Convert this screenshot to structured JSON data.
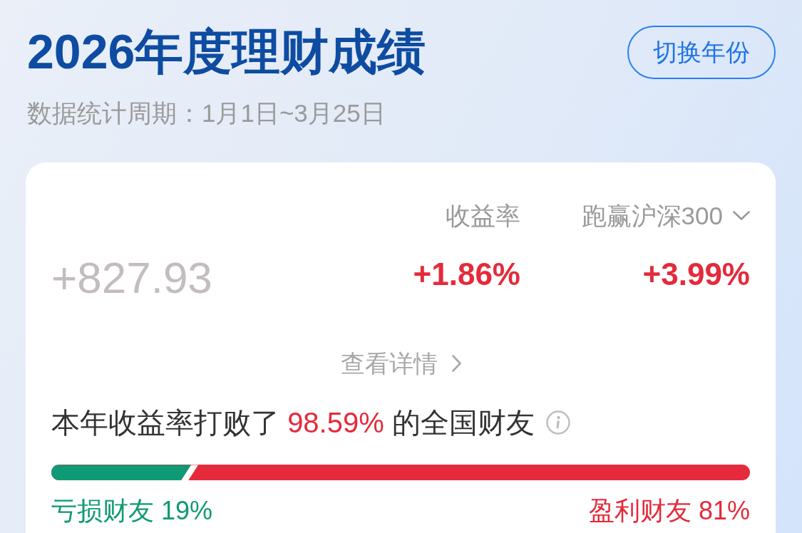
{
  "header": {
    "title": "2026年度理财成绩",
    "switch_year_button": "切换年份",
    "period": "数据统计周期：1月1日~3月25日"
  },
  "summary": {
    "amount": "+827.93",
    "metrics": [
      {
        "label": "收益率",
        "value": "+1.86%",
        "dropdown": false
      },
      {
        "label": "跑赢沪深300",
        "value": "+3.99%",
        "dropdown": true
      }
    ],
    "details_link": "查看详情"
  },
  "ranking": {
    "text_before": "本年收益率打败了 ",
    "highlight": "98.59%",
    "text_after": " 的全国财友"
  },
  "distribution": {
    "level": 0.2,
    "losing_label": "亏损财友 19%",
    "winning_label": "盈利财友 81%"
  }
}
